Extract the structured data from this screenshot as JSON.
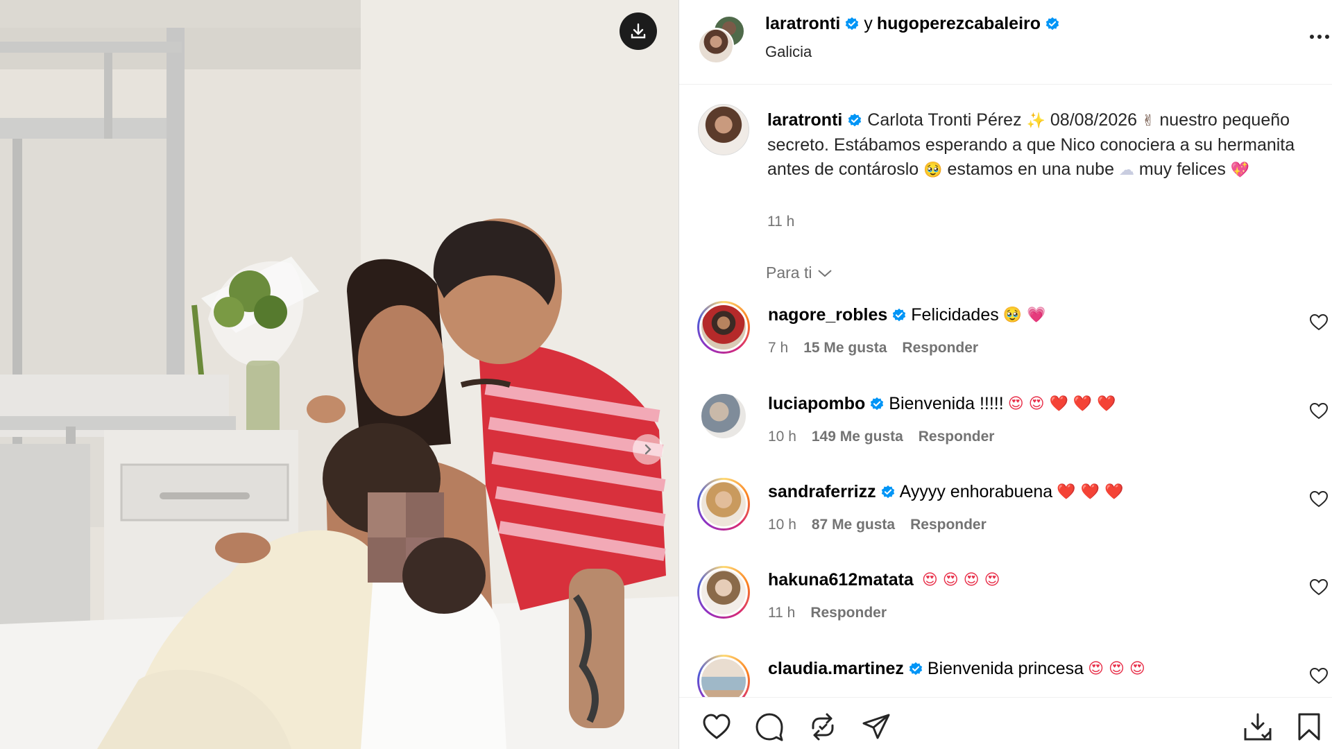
{
  "header": {
    "user1": "laratronti",
    "conjunction": "y",
    "user2": "hugoperezcabaleiro",
    "location": "Galicia"
  },
  "caption": {
    "username": "laratronti",
    "text_part1": "Carlota Tronti Pérez",
    "emoji1": "✨",
    "text_part2": "08/08/2026",
    "emoji2": "✌",
    "text_part3": "nuestro pequeño secreto. Estábamos esperando a que Nico conociera a su hermanita antes de contároslo",
    "emoji3": "🥹",
    "text_part4": "estamos en una nube",
    "emoji4": "☁",
    "text_part5": "muy felices",
    "emoji5": "💖",
    "time": "11 h"
  },
  "sort": {
    "label": "Para ti"
  },
  "comments": [
    {
      "username": "nagore_robles",
      "text": "Felicidades",
      "emojis": "🥹 💗",
      "time": "7 h",
      "likes": "15 Me gusta",
      "reply": "Responder"
    },
    {
      "username": "luciapombo",
      "text": "Bienvenida !!!!!",
      "emojis": "😍 😍 ❤️ ❤️ ❤️",
      "time": "10 h",
      "likes": "149 Me gusta",
      "reply": "Responder"
    },
    {
      "username": "sandraferrizz",
      "text": "Ayyyy enhorabuena",
      "emojis": "❤️ ❤️ ❤️",
      "time": "10 h",
      "likes": "87 Me gusta",
      "reply": "Responder"
    },
    {
      "username": "hakuna612matata",
      "text": "",
      "emojis": "😍 😍 😍 😍",
      "time": "11 h",
      "likes": "",
      "reply": "Responder"
    },
    {
      "username": "claudia.martinez",
      "text": "Bienvenida princesa",
      "emojis": "😍 😍 😍",
      "time": "",
      "likes": "",
      "reply": ""
    }
  ],
  "icons": {
    "download": "download-icon",
    "next": "chevron-right-icon",
    "more": "more-icon",
    "verified": "verified-badge-icon",
    "like": "heart-icon",
    "comment": "comment-icon",
    "repost": "repost-icon",
    "share": "share-icon",
    "save_image": "save-image-icon",
    "bookmark": "bookmark-icon"
  },
  "colors": {
    "verified": "#0095f6",
    "secondary_text": "#737373",
    "heart_red": "#e8304a",
    "shirt_red": "#d8303c"
  }
}
